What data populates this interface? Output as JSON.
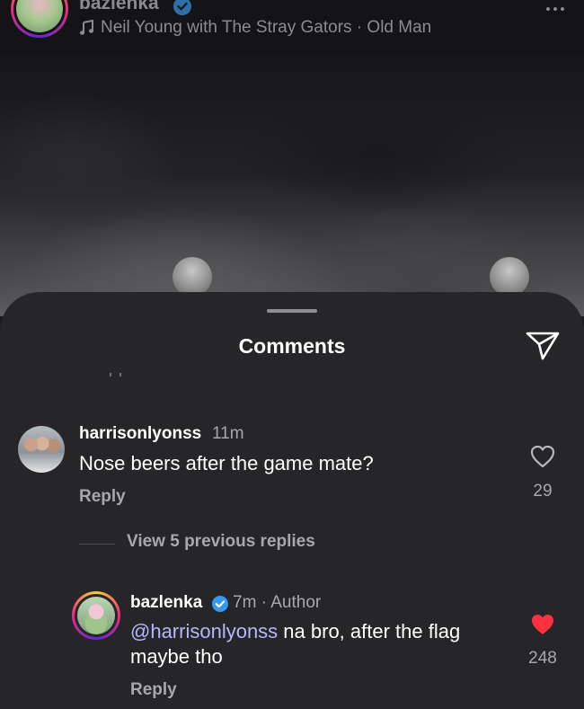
{
  "post_header": {
    "username": "bazlenka",
    "music_track": "Neil Young with The Stray Gators · Old Man"
  },
  "comments_sheet": {
    "title": "Comments",
    "comments": [
      {
        "username": "harrisonlyonss",
        "time": "11m",
        "text": "Nose beers after the game mate?",
        "reply_label": "Reply",
        "likes": "29",
        "liked": false
      }
    ],
    "view_replies_label": "View 5 previous replies",
    "reply": {
      "username": "bazlenka",
      "meta": "7m · Author",
      "mention": "@harrisonlyonss",
      "text": " na bro, after the flag maybe tho",
      "reply_label": "Reply",
      "likes": "248",
      "liked": true
    }
  },
  "colors": {
    "sheet_bg": "#262628",
    "liked_heart": "#ff3040",
    "verified_badge": "#3897f0",
    "mention": "#b9b5ff"
  },
  "icons": [
    "music-note-icon",
    "verified-badge-icon",
    "more-options-icon",
    "send-icon",
    "heart-outline-icon",
    "heart-filled-icon"
  ]
}
